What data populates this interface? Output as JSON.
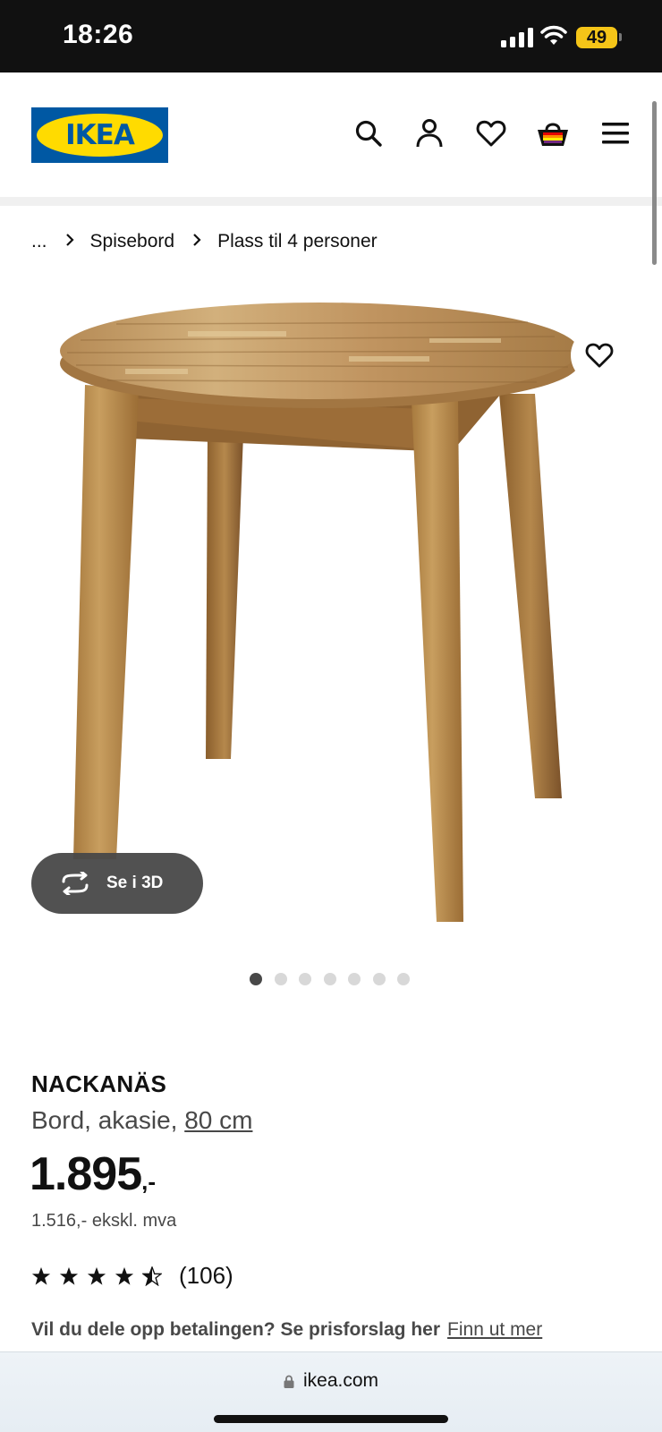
{
  "status_bar": {
    "time": "18:26",
    "battery": "49",
    "icons": [
      "cellular-signal-icon",
      "wifi-icon",
      "battery-icon"
    ]
  },
  "header": {
    "logo_text": "IKEA",
    "icons": [
      "search-icon",
      "account-icon",
      "favorites-icon",
      "shopping-bag-icon",
      "menu-icon"
    ],
    "colors": {
      "logo_blue": "#0058a3",
      "logo_yellow": "#ffdb00"
    }
  },
  "breadcrumb": {
    "items": [
      "...",
      "Spisebord",
      "Plass til 4 personer"
    ]
  },
  "gallery": {
    "view3d_label": "Se i 3D",
    "total_images": 7,
    "active_index": 1
  },
  "product": {
    "name": "NACKANÄS",
    "description_prefix": "Bord, akasie, ",
    "size": "80 cm",
    "price_main": "1.895",
    "price_suffix": ",-",
    "price_ex_vat": "1.516,- ekskl. mva",
    "rating_stars": 4.5,
    "rating_count": "(106)",
    "installment_text": "Vil du dele opp betalingen? Se prisforslag her",
    "installment_link": "Finn ut mer"
  },
  "browser": {
    "url": "ikea.com"
  }
}
